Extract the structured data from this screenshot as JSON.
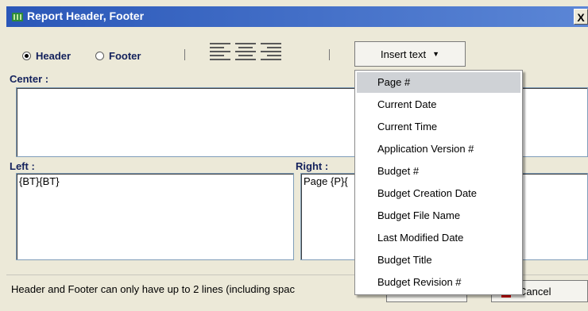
{
  "window": {
    "title": "Report Header, Footer",
    "close_label": "X"
  },
  "mode": {
    "header_label": "Header",
    "footer_label": "Footer",
    "selected": "Header"
  },
  "alignment_icons": [
    "align-left-icon",
    "align-center-icon",
    "align-right-icon"
  ],
  "insert_button": {
    "label": "Insert text"
  },
  "sections": {
    "center_label": "Center :",
    "center_value": "",
    "left_label": "Left :",
    "left_value": "{BT}{BT}",
    "right_label": "Right :",
    "right_value": "Page {P}{"
  },
  "status": {
    "text": "Header and Footer can only have up to 2 lines (including spac"
  },
  "buttons": {
    "cancel_label": "Cancel"
  },
  "menu": {
    "items": [
      "Page #",
      "Current Date",
      "Current Time",
      "Application Version #",
      "Budget #",
      "Budget Creation Date",
      "Budget File Name",
      "Last Modified Date",
      "Budget Title",
      "Budget Revision #"
    ]
  }
}
